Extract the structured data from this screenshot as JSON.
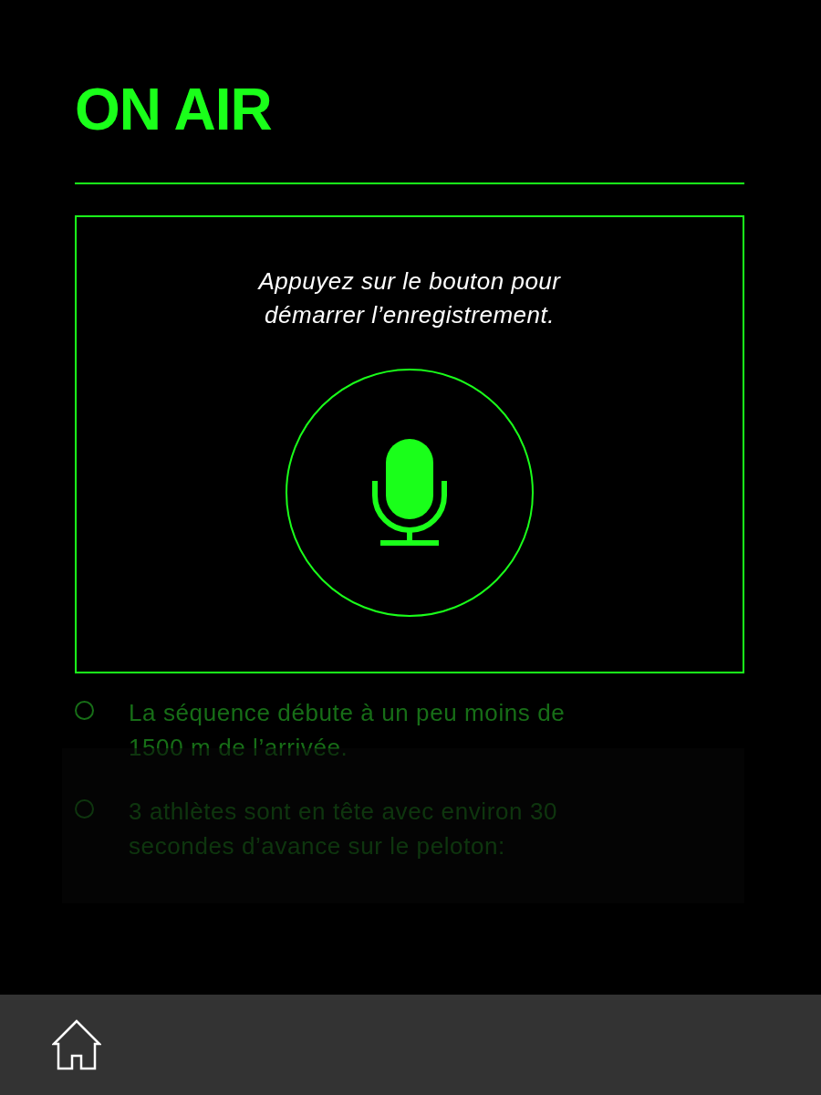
{
  "header": {
    "title": "ON AIR"
  },
  "dialog": {
    "prompt": "Appuyez sur le bouton pour démarrer l’enregistrement."
  },
  "options": [
    {
      "text": "La séquence débute à un peu moins de 1500 m de l’arrivée.",
      "selected": false
    },
    {
      "text": "3 athlètes sont en tête avec environ 30 secondes d’avance sur le peloton:",
      "selected": false
    }
  ]
}
